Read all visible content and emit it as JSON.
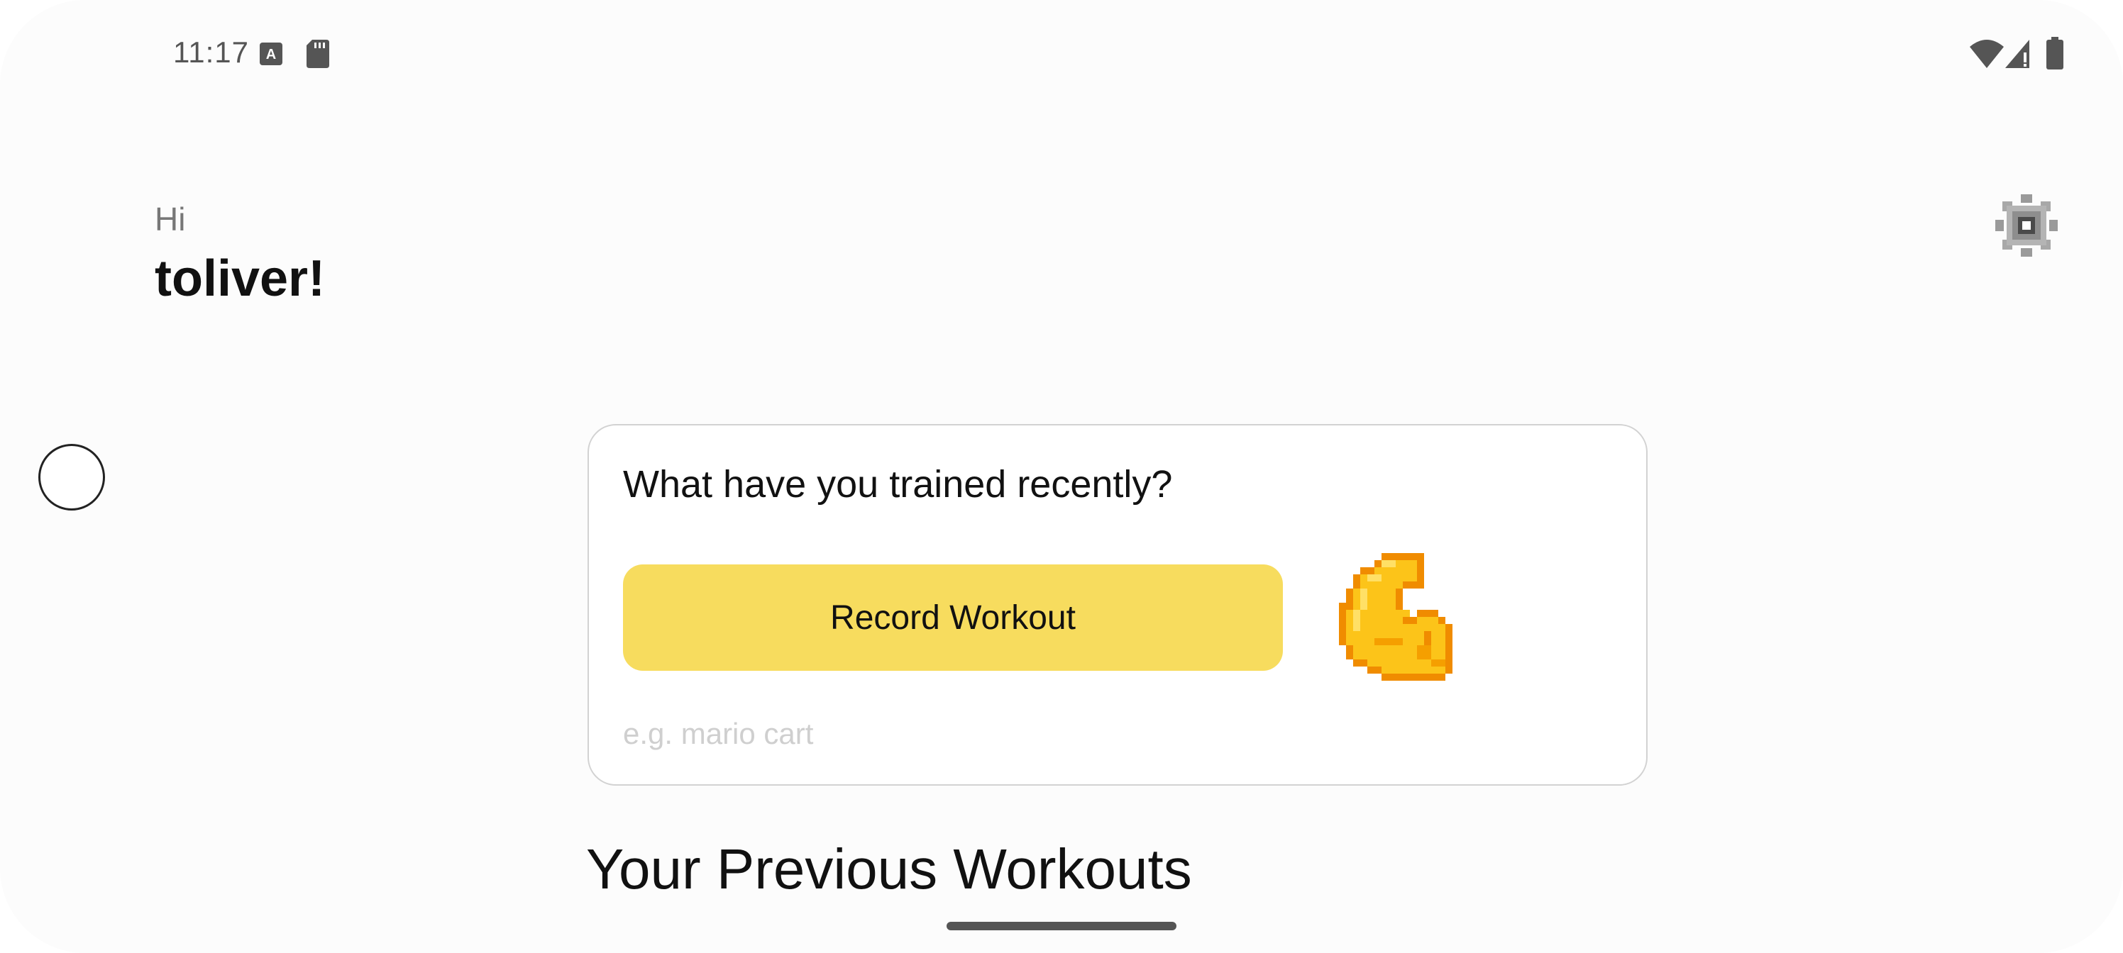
{
  "status_bar": {
    "time": "11:17",
    "left_icons": [
      "font-a-icon",
      "sd-card-icon"
    ],
    "right_icons": [
      "wifi-icon",
      "signal-icon",
      "battery-icon"
    ]
  },
  "greeting": {
    "hi": "Hi",
    "name": "toliver!"
  },
  "header": {
    "settings_icon": "gear-icon"
  },
  "card": {
    "title": "What have you trained recently?",
    "record_button_label": "Record Workout",
    "input_placeholder": "e.g. mario cart",
    "input_value": "",
    "icon": "flexed-bicep-icon"
  },
  "section": {
    "previous_workouts_title": "Your Previous Workouts"
  },
  "colors": {
    "accent": "#f7dc5e",
    "bicep_fill": "#fcc419",
    "bicep_outline": "#f08c00"
  }
}
